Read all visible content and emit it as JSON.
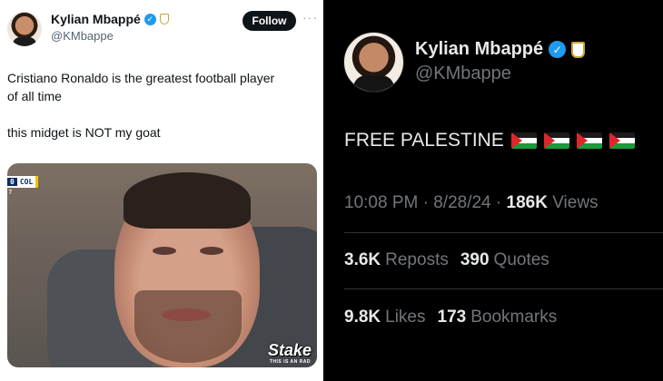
{
  "left_tweet": {
    "author_name": "Kylian Mbappé",
    "author_handle": "@KMbappe",
    "follow_label": "Follow",
    "more_label": "···",
    "verified_glyph": "✓",
    "text_lines": [
      "Cristiano Ronaldo is the greatest football player",
      "of all time",
      "",
      "this midget is NOT my goat"
    ],
    "media": {
      "scoreboard_num": "0",
      "scoreboard_team": "COL",
      "scoreboard_sub": "7",
      "brand": "Stake",
      "brand_sub": "THIS IS AN RAD"
    }
  },
  "right_tweet": {
    "author_name": "Kylian Mbappé",
    "author_handle": "@KMbappe",
    "verified_glyph": "✓",
    "text": "FREE PALESTINE",
    "flags": [
      "palestine-flag",
      "palestine-flag",
      "palestine-flag",
      "palestine-flag"
    ],
    "time": "10:08 PM",
    "date": "8/28/24",
    "views_count": "186K",
    "views_label": "Views",
    "reposts_count": "3.6K",
    "reposts_label": "Reposts",
    "quotes_count": "390",
    "quotes_label": "Quotes",
    "likes_count": "9.8K",
    "likes_label": "Likes",
    "bookmarks_count": "173",
    "bookmarks_label": "Bookmarks",
    "separator": "·"
  },
  "colors": {
    "verified_blue": "#1d9bf0",
    "dark_bg": "#000000",
    "muted_text": "#71767b",
    "light_text": "#e7e9ea"
  }
}
